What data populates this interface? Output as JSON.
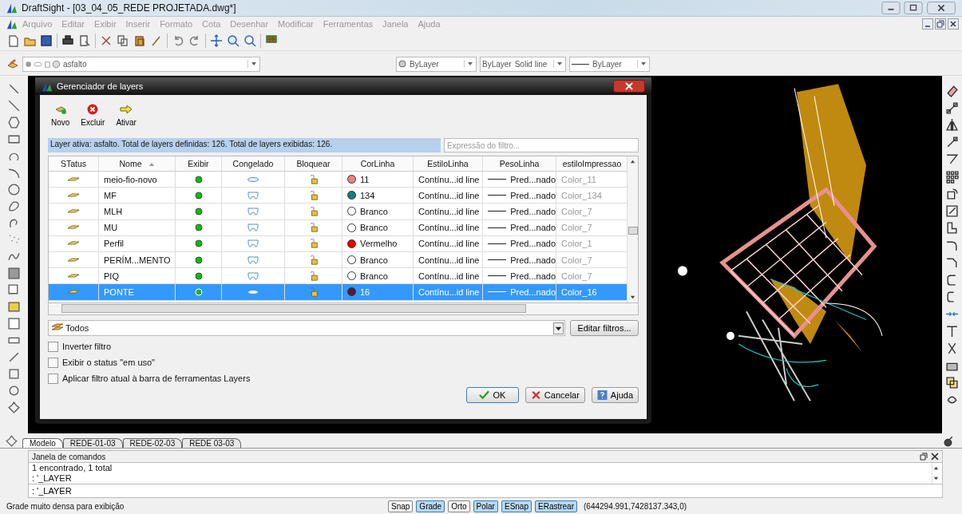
{
  "window": {
    "title": "DraftSight - [03_04_05_REDE PROJETADA.dwg*]"
  },
  "menu": [
    "Arquivo",
    "Editar",
    "Exibir",
    "Inserir",
    "Formato",
    "Cota",
    "Desenhar",
    "Modificar",
    "Ferramentas",
    "Janela",
    "Ajuda"
  ],
  "layer_toolbar": {
    "layer": "asfalto",
    "color_setting": "ByLayer",
    "linestyle": "ByLayer",
    "linestyle_type": "Solid line",
    "lineweight": "ByLayer"
  },
  "dialog": {
    "title": "Gerenciador de layers",
    "actions": [
      {
        "kind": "new",
        "label": "Novo"
      },
      {
        "kind": "delete",
        "label": "Excluir"
      },
      {
        "kind": "activate",
        "label": "Ativar"
      }
    ],
    "info": "Layer ativa: asfalto. Total de layers definidas: 126. Total de layers exibidas: 126.",
    "filter_placeholder": "Expressão do filtro...",
    "columns": [
      "STatus",
      "Nome",
      "Exibir",
      "Congelado",
      "Bloquear",
      "CorLinha",
      "EstiloLinha",
      "PesoLinha",
      "estiloImpressao"
    ],
    "rows": [
      {
        "name": "meio-fio-novo",
        "frozen": false,
        "color": "#f08080",
        "color_label": "11",
        "linestyle": "Contínu...id line",
        "lineweight": "Pred...nado",
        "print_style": "Color_11",
        "selected": false
      },
      {
        "name": "MF",
        "frozen": true,
        "color": "#108080",
        "color_label": "134",
        "linestyle": "Contínu...id line",
        "lineweight": "Pred...nado",
        "print_style": "Color_134",
        "selected": false
      },
      {
        "name": "MLH",
        "frozen": true,
        "color": "#ffffff",
        "color_label": "Branco",
        "linestyle": "Contínu...id line",
        "lineweight": "Pred...nado",
        "print_style": "Color_7",
        "selected": false
      },
      {
        "name": "MU",
        "frozen": true,
        "color": "#ffffff",
        "color_label": "Branco",
        "linestyle": "Contínu...id line",
        "lineweight": "Pred...nado",
        "print_style": "Color_7",
        "selected": false
      },
      {
        "name": "Perfil",
        "frozen": true,
        "color": "#ee0000",
        "color_label": "Vermelho",
        "linestyle": "Contínu...id line",
        "lineweight": "Pred...nado",
        "print_style": "Color_1",
        "selected": false
      },
      {
        "name": "PERÍM...MENTO",
        "frozen": true,
        "color": "#ffffff",
        "color_label": "Branco",
        "linestyle": "Contínu...id line",
        "lineweight": "Pred...nado",
        "print_style": "Color_7",
        "selected": false
      },
      {
        "name": "PIQ",
        "frozen": true,
        "color": "#ffffff",
        "color_label": "Branco",
        "linestyle": "Contínu...id line",
        "lineweight": "Pred...nado",
        "print_style": "Color_7",
        "selected": false
      },
      {
        "name": "PONTE",
        "frozen": false,
        "color": "#5a1838",
        "color_label": "16",
        "linestyle": "Contínu...id line",
        "lineweight": "Pred...nado",
        "print_style": "Color_16",
        "selected": true
      }
    ],
    "filter": "Todos",
    "edit_filters": "Editar filtros...",
    "options": [
      {
        "label": "Inverter filtro",
        "checked": false
      },
      {
        "label": "Exibir o status \"em uso\"",
        "checked": false
      },
      {
        "label": "Aplicar filtro atual à barra de ferramentas Layers",
        "checked": false
      }
    ],
    "buttons": [
      {
        "kind": "ok",
        "label": "OK"
      },
      {
        "kind": "cancel",
        "label": "Cancelar"
      },
      {
        "kind": "help",
        "label": "Ajuda"
      }
    ]
  },
  "tabs": [
    {
      "label": "Modelo",
      "selected": true
    },
    {
      "label": "REDE-01-03",
      "selected": false
    },
    {
      "label": "REDE-02-03",
      "selected": false
    },
    {
      "label": "REDE 03-03",
      "selected": false
    }
  ],
  "command_window": {
    "title": "Janela de comandos",
    "history": [
      "1 encontrado, 1 total",
      ": '_LAYER"
    ],
    "input": ": '_LAYER"
  },
  "status_bar": {
    "message": "Grade muito densa para exibição",
    "toggles": [
      {
        "label": "Snap",
        "on": false
      },
      {
        "label": "Grade",
        "on": true
      },
      {
        "label": "Orto",
        "on": false
      },
      {
        "label": "Polar",
        "on": true
      },
      {
        "label": "ESnap",
        "on": true
      },
      {
        "label": "ERastrear",
        "on": true
      }
    ],
    "coordinates": "(644294.991,7428137.343,0)"
  }
}
